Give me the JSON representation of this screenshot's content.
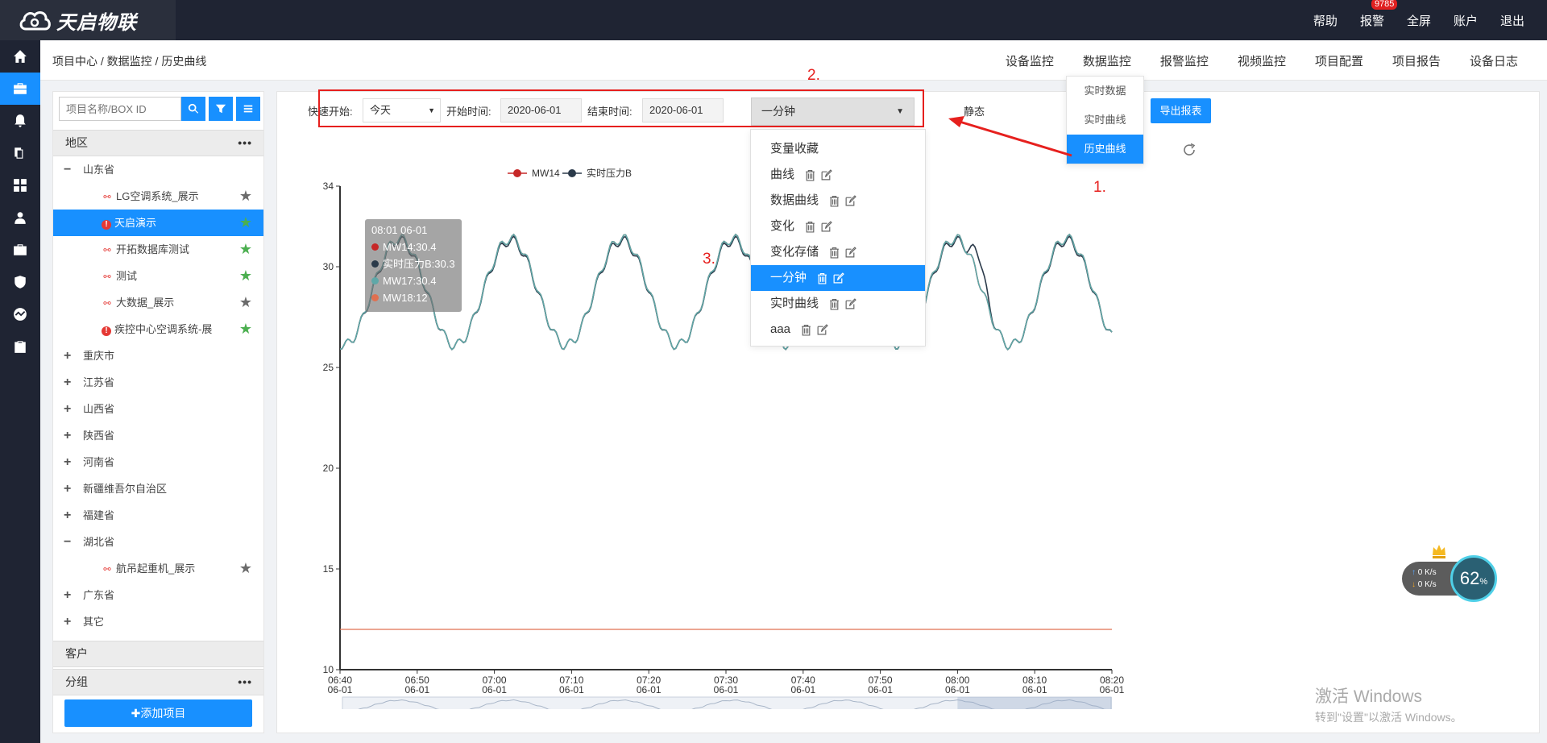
{
  "app": {
    "logo_text": "天启物联"
  },
  "topnav": {
    "help": "帮助",
    "alarm": "报警",
    "alarm_badge": "9785",
    "fullscreen": "全屏",
    "account": "账户",
    "logout": "退出"
  },
  "breadcrumb": "项目中心 / 数据监控 / 历史曲线",
  "modnav": [
    "设备监控",
    "数据监控",
    "报警监控",
    "视频监控",
    "项目配置",
    "项目报告",
    "设备日志"
  ],
  "data_menu": [
    "实时数据",
    "实时曲线",
    "历史曲线"
  ],
  "left": {
    "search_placeholder": "项目名称/BOX ID",
    "region_header": "地区",
    "region_more": "•••",
    "tree": [
      {
        "label": "山东省",
        "level": 1,
        "sign": "−"
      },
      {
        "label": "LG空调系统_展示",
        "level": 2,
        "status": "offline",
        "star": "grey"
      },
      {
        "label": "天启演示",
        "level": 2,
        "status": "warn",
        "star": "green",
        "selected": true
      },
      {
        "label": "开拓数据库测试",
        "level": 2,
        "status": "offline",
        "star": "green"
      },
      {
        "label": "测试",
        "level": 2,
        "status": "offline",
        "star": "green"
      },
      {
        "label": "大数据_展示",
        "level": 2,
        "status": "offline",
        "star": "grey"
      },
      {
        "label": "疾控中心空调系统-展",
        "level": 2,
        "status": "warn",
        "star": "green"
      },
      {
        "label": "重庆市",
        "level": 1,
        "sign": "+"
      },
      {
        "label": "江苏省",
        "level": 1,
        "sign": "+"
      },
      {
        "label": "山西省",
        "level": 1,
        "sign": "+"
      },
      {
        "label": "陕西省",
        "level": 1,
        "sign": "+"
      },
      {
        "label": "河南省",
        "level": 1,
        "sign": "+"
      },
      {
        "label": "新疆维吾尔自治区",
        "level": 1,
        "sign": "+"
      },
      {
        "label": "福建省",
        "level": 1,
        "sign": "+"
      },
      {
        "label": "湖北省",
        "level": 1,
        "sign": "−"
      },
      {
        "label": "航吊起重机_展示",
        "level": 2,
        "status": "offline",
        "star": "grey"
      },
      {
        "label": "广东省",
        "level": 1,
        "sign": "+"
      },
      {
        "label": "其它",
        "level": 1,
        "sign": "+"
      }
    ],
    "customer_header": "客户",
    "group_header": "分组",
    "group_more": "•••",
    "add_button": "✚添加项目"
  },
  "toolbar": {
    "quick_label": "快速开始:",
    "quick_value": "今天",
    "start_label": "开始时间:",
    "start_value": "2020-06-01",
    "end_label": "结束时间:",
    "end_value": "2020-06-01",
    "period_value": "一分钟",
    "static_label": "静态",
    "export_label": "导出报表"
  },
  "period_menu": [
    {
      "label": "变量收藏",
      "icons": false
    },
    {
      "label": "曲线",
      "icons": true
    },
    {
      "label": "数据曲线",
      "icons": true
    },
    {
      "label": "变化",
      "icons": true
    },
    {
      "label": "变化存储",
      "icons": true
    },
    {
      "label": "一分钟",
      "icons": true,
      "selected": true
    },
    {
      "label": "实时曲线",
      "icons": true
    },
    {
      "label": "aaa",
      "icons": true
    }
  ],
  "annotations": {
    "a1": "1.",
    "a2": "2.",
    "a3": "3."
  },
  "tooltip": {
    "title": "08:01 06-01",
    "rows": [
      {
        "text": "MW14:30.4",
        "color": "#c62828"
      },
      {
        "text": "实时压力B:30.3",
        "color": "#2b3a4a"
      },
      {
        "text": "MW17:30.4",
        "color": "#5fa8a8"
      },
      {
        "text": "MW18:12",
        "color": "#e07050"
      }
    ]
  },
  "speed": {
    "up": "0 K/s",
    "down": "0 K/s",
    "percent": "62",
    "unit": "%"
  },
  "watermark": {
    "line1": "激活 Windows",
    "line2": "转到\"设置\"以激活 Windows。"
  },
  "colors": {
    "accent": "#1890ff",
    "annotation": "#e6201e",
    "dark": "#1f2433"
  },
  "chart_data": {
    "type": "line",
    "legend": [
      "MW14",
      "实时压力B"
    ],
    "yticks": [
      10,
      15,
      20,
      25,
      30,
      34
    ],
    "ylim": [
      10,
      34
    ],
    "xticks": [
      "06:40",
      "06:50",
      "07:00",
      "07:10",
      "07:20",
      "07:30",
      "07:40",
      "07:50",
      "08:00",
      "08:10",
      "08:20"
    ],
    "xtick_date": "06-01",
    "xlim_minutes": [
      0,
      100
    ],
    "series": [
      {
        "name": "MW14",
        "color": "#c62828",
        "min": 26.1,
        "max": 31.4,
        "period_minutes": 14.4,
        "phase_min": 0.5
      },
      {
        "name": "实时压力B",
        "color": "#2b3a4a",
        "min": 26.1,
        "max": 31.3,
        "period_minutes": 14.4,
        "phase_min": 0.5,
        "spike_at": 82.8,
        "spike_value": 31.8
      },
      {
        "name": "MW17",
        "color": "#5fa8a8",
        "min": 26.1,
        "max": 31.4,
        "period_minutes": 14.4,
        "phase_min": 0.5
      },
      {
        "name": "MW18",
        "color": "#e07050",
        "constant": 12
      }
    ]
  }
}
